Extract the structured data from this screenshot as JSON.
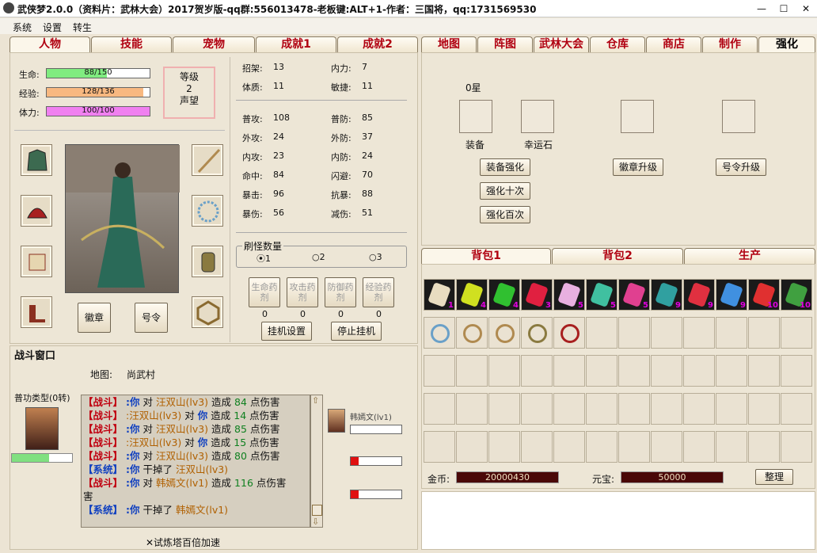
{
  "window": {
    "title": "武侠梦2.0.0（资料片：武林大会）2017贺岁版-qq群:556013478-老板键:ALT+1-作者：三国将，qq:1731569530",
    "min": "—",
    "max": "☐",
    "close": "✕"
  },
  "menu": [
    "系统",
    "设置",
    "转生"
  ],
  "left_tabs": [
    "人物",
    "技能",
    "宠物",
    "成就1",
    "成就2"
  ],
  "right_tabs": [
    "地图",
    "阵图",
    "武林大会",
    "仓库",
    "商店",
    "制作",
    "强化"
  ],
  "char": {
    "hp_label": "生命:",
    "hp": "88/150",
    "hp_pct": 0.587,
    "exp_label": "经验:",
    "exp": "128/136",
    "exp_pct": 0.94,
    "sta_label": "体力:",
    "sta": "100/100",
    "sta_pct": 1.0,
    "level_label": "等级",
    "level": "2",
    "fame_label": "声望"
  },
  "attrs": [
    [
      "招架:",
      "13",
      "内力:",
      "7"
    ],
    [
      "体质:",
      "11",
      "敏捷:",
      "11"
    ]
  ],
  "combat": [
    [
      "普攻:",
      "108",
      "普防:",
      "85"
    ],
    [
      "外攻:",
      "24",
      "外防:",
      "37"
    ],
    [
      "内攻:",
      "23",
      "内防:",
      "24"
    ],
    [
      "命中:",
      "84",
      "闪避:",
      "70"
    ],
    [
      "暴击:",
      "96",
      "抗暴:",
      "88"
    ],
    [
      "暴伤:",
      "56",
      "减伤:",
      "51"
    ]
  ],
  "spawn": {
    "title": "刷怪数量",
    "opts": [
      "1",
      "2",
      "3"
    ]
  },
  "potions": [
    {
      "label": "生命药剂",
      "count": "0"
    },
    {
      "label": "攻击药剂",
      "count": "0"
    },
    {
      "label": "防御药剂",
      "count": "0"
    },
    {
      "label": "经验药剂",
      "count": "0"
    }
  ],
  "idle_buttons": [
    "挂机设置",
    "停止挂机"
  ],
  "badge_btn": "徽章",
  "order_btn": "号令",
  "battle": {
    "title": "战斗窗口",
    "map_label": "地图:",
    "map": "尚武村",
    "attack_type": "普功类型(0转)",
    "enemy": "韩嫣文(lv1)",
    "enemy_hp_pct": 0.0,
    "enemy2_pct": 0.15,
    "enemy3_pct": 0.15,
    "player_hp_pct": 0.62,
    "speed": "✕试炼塔百倍加速"
  },
  "log": [
    {
      "tag": "【战斗】",
      "a": ":你",
      "v": "对",
      "t": "汪双山(lv3)",
      "m": "造成",
      "n": "84",
      "e": "点伤害"
    },
    {
      "tag": "【战斗】",
      "a": ":汪双山(lv3)",
      "v": "对",
      "t": "你",
      "m": "造成",
      "n": "14",
      "e": "点伤害"
    },
    {
      "tag": "【战斗】",
      "a": ":你",
      "v": "对",
      "t": "汪双山(lv3)",
      "m": "造成",
      "n": "85",
      "e": "点伤害"
    },
    {
      "tag": "【战斗】",
      "a": ":汪双山(lv3)",
      "v": "对",
      "t": "你",
      "m": "造成",
      "n": "15",
      "e": "点伤害"
    },
    {
      "tag": "【战斗】",
      "a": ":你",
      "v": "对",
      "t": "汪双山(lv3)",
      "m": "造成",
      "n": "80",
      "e": "点伤害"
    },
    {
      "tag": "【系统】",
      "a": ":你",
      "v": "干掉了",
      "t": "汪双山(lv3)",
      "m": "",
      "n": "",
      "e": ""
    },
    {
      "tag": "【战斗】",
      "a": ":你",
      "v": "对",
      "t": "韩嫣文(lv1)",
      "m": "造成",
      "n": "116",
      "e": "点伤害"
    },
    {
      "tag": "",
      "a": "",
      "v": "",
      "t": "",
      "m": "",
      "n": "",
      "e": "害"
    },
    {
      "tag": "【系统】",
      "a": ":你",
      "v": "干掉了",
      "t": "韩嫣文(lv1)",
      "m": "",
      "n": "",
      "e": ""
    }
  ],
  "enhance": {
    "star": "0星",
    "slots": [
      "装备",
      "幸运石"
    ],
    "buttons": [
      "装备强化",
      "强化十次",
      "强化百次",
      "徽章升级",
      "号令升级"
    ]
  },
  "bag_tabs": [
    "背包1",
    "背包2",
    "生产"
  ],
  "bag_counts": [
    "1",
    "4",
    "4",
    "3",
    "5",
    "5",
    "5",
    "9",
    "9",
    "9",
    "10",
    "10"
  ],
  "gold_label": "金币:",
  "gold": "20000430",
  "yuanbao_label": "元宝:",
  "yuanbao": "50000",
  "sort_btn": "整理"
}
